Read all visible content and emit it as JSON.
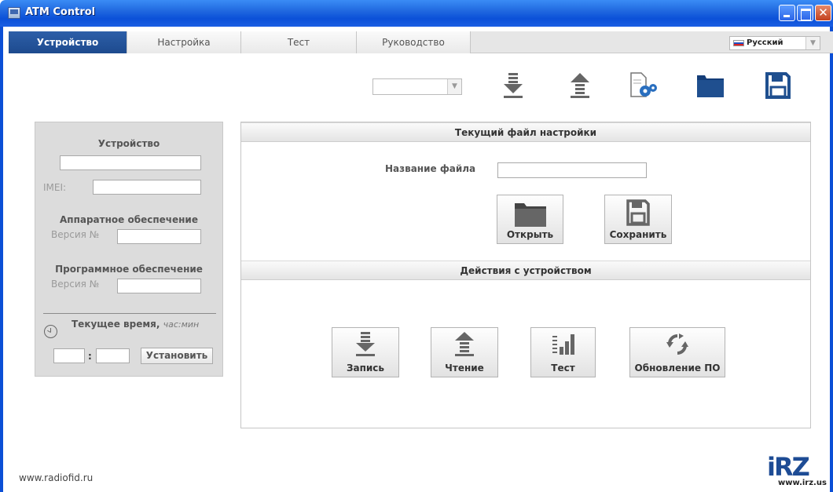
{
  "window": {
    "title": "ATM Control"
  },
  "tabs": [
    {
      "label": "Устройство",
      "active": true
    },
    {
      "label": "Настройка",
      "active": false
    },
    {
      "label": "Тест",
      "active": false
    },
    {
      "label": "Руководство",
      "active": false
    }
  ],
  "language": {
    "selected": "Русский"
  },
  "toolbar": {
    "select_value": "",
    "icons": [
      "download-icon",
      "upload-icon",
      "file-settings-icon",
      "folder-icon",
      "save-icon"
    ]
  },
  "device_panel": {
    "device_heading": "Устройство",
    "device_name_value": "",
    "imei_label": "IMEI:",
    "imei_value": "",
    "hardware_heading": "Аппаратное обеспечение",
    "hardware_version_label": "Версия №",
    "hardware_version_value": "",
    "software_heading": "Программное обеспечение",
    "software_version_label": "Версия №",
    "software_version_value": "",
    "time_label": "Текущее время,",
    "time_format": "час:мин",
    "hours_value": "",
    "minutes_value": "",
    "colon": ":",
    "set_button": "Установить"
  },
  "settings_file": {
    "header": "Текущий файл настройки",
    "filename_label": "Название файла",
    "filename_value": "",
    "open_button": "Открыть",
    "save_button": "Сохранить"
  },
  "device_actions": {
    "header": "Действия с устройством",
    "write_button": "Запись",
    "read_button": "Чтение",
    "test_button": "Тест",
    "update_button": "Обновление ПО"
  },
  "footer": {
    "website": "www.radiofid.ru",
    "logo_url_text": "www.irz.us"
  },
  "colors": {
    "titlebar": "#0b50d8",
    "active_tab": "#1d4a8e",
    "icon_blue": "#1f4f8f",
    "icon_gray": "#888888"
  }
}
